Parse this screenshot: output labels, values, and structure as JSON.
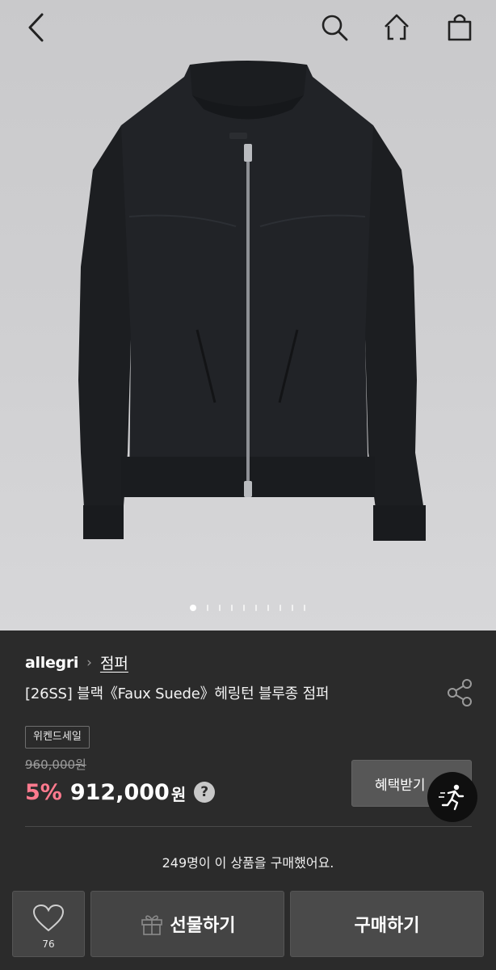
{
  "header": {
    "back_icon": "back-chevron-icon",
    "search_icon": "search-icon",
    "home_icon": "home-icon",
    "cart_icon": "shopping-bag-icon"
  },
  "carousel": {
    "total": 10,
    "active_index": 0
  },
  "product": {
    "brand": "allegri",
    "category": "점퍼",
    "title": "[26SS] 블랙《Faux Suede》헤링턴 블루종 점퍼",
    "badge": "위켄드세일",
    "original_price": "960,000원",
    "discount": "5%",
    "price": "912,000",
    "currency": "원",
    "help_label": "?",
    "benefit_button": "혜택받기",
    "purchase_count_text": "249명이 이 상품을 구매했어요."
  },
  "bottom_bar": {
    "like_count": "76",
    "gift_label": "선물하기",
    "buy_label": "구매하기"
  },
  "colors": {
    "background": "#2b2b2b",
    "discount": "#ff7a8e",
    "button": "#444444"
  }
}
